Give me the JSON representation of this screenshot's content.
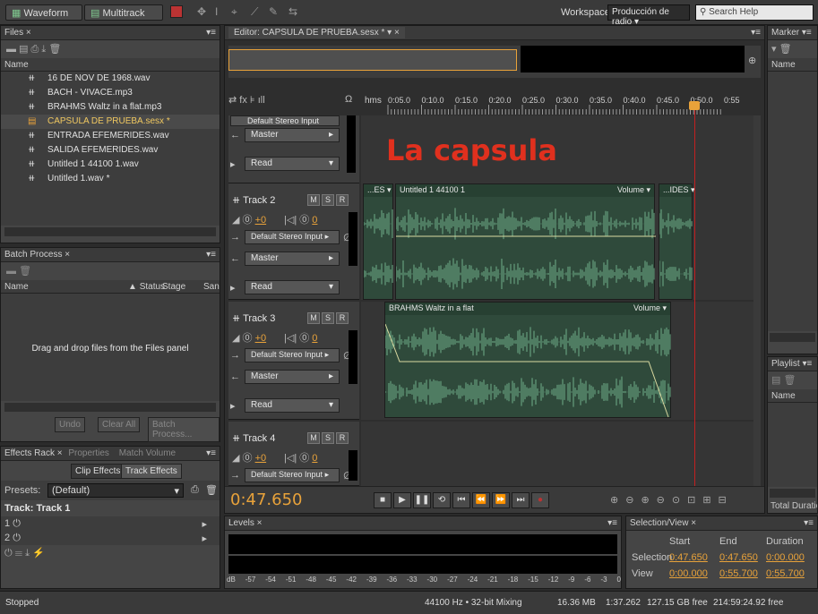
{
  "top": {
    "waveform_label": "Waveform",
    "multitrack_label": "Multitrack",
    "workspace_label": "Workspace:",
    "workspace_value": "Producción de radio",
    "search_placeholder": "Search Help"
  },
  "files": {
    "title": "Files",
    "col_name": "Name",
    "items": [
      "16 DE NOV DE 1968.wav",
      "BACH - VIVACE.mp3",
      "BRAHMS Waltz in a flat.mp3",
      "CAPSULA DE PRUEBA.sesx *",
      "ENTRADA EFEMERIDES.wav",
      "SALIDA EFEMERIDES.wav",
      "Untitled 1 44100 1.wav",
      "Untitled 1.wav *"
    ]
  },
  "batch": {
    "title": "Batch Process",
    "col_name": "Name",
    "col_status": "Status",
    "col_stage": "Stage",
    "col_san": "San",
    "drop_text": "Drag and drop files from the Files panel",
    "undo": "Undo",
    "clear_all": "Clear All",
    "batch_process": "Batch Process..."
  },
  "effects": {
    "tab_rack": "Effects Rack",
    "tab_properties": "Properties",
    "tab_match": "Match Volume",
    "clip_effects": "Clip Effects",
    "track_effects": "Track Effects",
    "presets_label": "Presets:",
    "presets_value": "(Default)",
    "track_label": "Track: Track 1",
    "slot1": "1",
    "slot2": "2"
  },
  "editor": {
    "tab": "Editor: CAPSULA DE PRUEBA.sesx *",
    "time": "0:47.650",
    "overlay_title": "La capsula",
    "ruler_unit": "hms",
    "ruler": [
      "0:05.0",
      "0:10.0",
      "0:15.0",
      "0:20.0",
      "0:25.0",
      "0:30.0",
      "0:35.0",
      "0:40.0",
      "0:45.0",
      "0:50.0",
      "0:55"
    ],
    "track1": {
      "input": "Default Stereo Input",
      "output": "Master",
      "automation": "Read"
    },
    "tracks": [
      {
        "name": "Track 2",
        "volume": "+0",
        "pan": "0",
        "input": "Default Stereo Input",
        "output": "Master",
        "automation": "Read",
        "clips": [
          {
            "label": "...ES"
          },
          {
            "label": "Untitled 1 44100 1",
            "param": "Volume"
          },
          {
            "label": "...IDES"
          }
        ]
      },
      {
        "name": "Track 3",
        "volume": "+0",
        "pan": "0",
        "input": "Default Stereo Input",
        "output": "Master",
        "automation": "Read",
        "clips": [
          {
            "label": "BRAHMS Waltz in a flat",
            "param": "Volume"
          }
        ]
      },
      {
        "name": "Track 4",
        "volume": "+0",
        "pan": "0",
        "input": "Default Stereo Input"
      }
    ],
    "msr": [
      "M",
      "S",
      "R"
    ]
  },
  "markers": {
    "title": "Marker",
    "col_name": "Name"
  },
  "playlist": {
    "title": "Playlist",
    "col_name": "Name",
    "total": "Total Duration"
  },
  "levels": {
    "title": "Levels",
    "scale": [
      "dB",
      "-57",
      "-54",
      "-51",
      "-48",
      "-45",
      "-42",
      "-39",
      "-36",
      "-33",
      "-30",
      "-27",
      "-24",
      "-21",
      "-18",
      "-15",
      "-12",
      "-9",
      "-6",
      "-3",
      "0"
    ]
  },
  "selection": {
    "title": "Selection/View",
    "col_start": "Start",
    "col_end": "End",
    "col_duration": "Duration",
    "row1_label": "Selection",
    "row1_start": "0:47.650",
    "row1_end": "0:47.650",
    "row1_dur": "0:00.000",
    "row2_label": "View",
    "row2_start": "0:00.000",
    "row2_end": "0:55.700",
    "row2_dur": "0:55.700"
  },
  "status": {
    "state": "Stopped",
    "format": "44100 Hz • 32-bit Mixing",
    "size": "16.36 MB",
    "duration": "1:37.262",
    "free": "127.15 GB free",
    "free_time": "214:59:24.92 free"
  },
  "colors": {
    "accent": "#e8a23a",
    "time": "#e8a23a",
    "overlay": "#e0301e",
    "playhead": "#c42020",
    "waveform": "#6fae8a",
    "clip_bg": "#2f4a3b"
  }
}
